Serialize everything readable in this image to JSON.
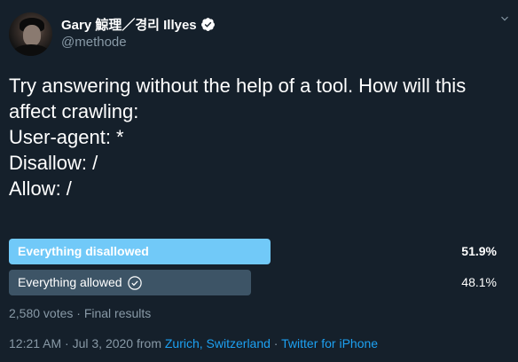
{
  "author": {
    "display_name": "Gary 鯨理／경리 Illyes",
    "handle": "@methode",
    "verified_icon": "verified-badge-icon"
  },
  "tweet": {
    "lines": [
      "Try answering without the help of a tool. How will this",
      "affect crawling:",
      "",
      "User-agent: *",
      "Disallow: /",
      "Allow: /"
    ]
  },
  "poll": {
    "options": [
      {
        "label": "Everything disallowed",
        "percent_text": "51.9%",
        "percent": 51.9,
        "winner": true
      },
      {
        "label": "Everything allowed",
        "percent_text": "48.1%",
        "percent": 48.1,
        "winner": false,
        "voted": true
      }
    ],
    "summary": "2,580 votes · Final results"
  },
  "meta": {
    "time": "12:21 AM · Jul 3, 2020 from ",
    "location": "Zurich, Switzerland",
    "separator": " · ",
    "source": "Twitter for iPhone"
  },
  "colors": {
    "background": "#15202b",
    "accent": "#1da1f2",
    "winner_bar": "#71c9f8",
    "loser_bar": "#3d5466",
    "muted_text": "#8899a6"
  }
}
